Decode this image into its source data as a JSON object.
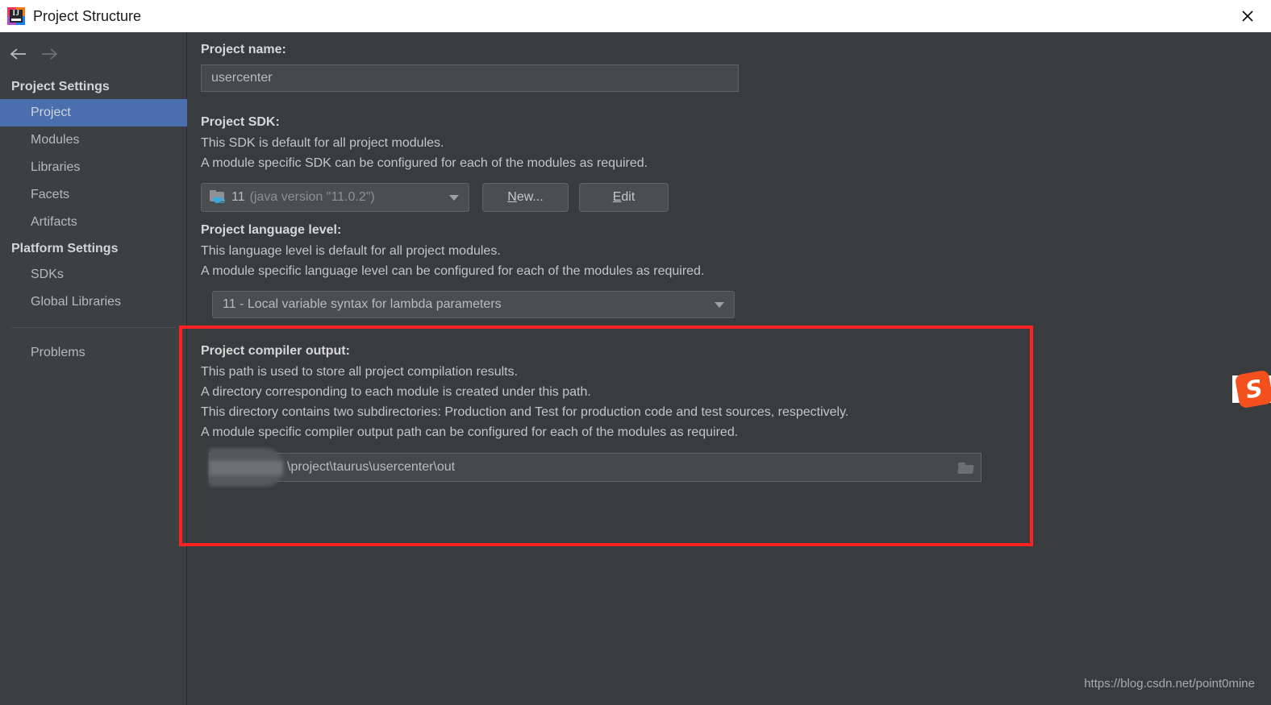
{
  "window": {
    "title": "Project Structure",
    "app_icon": "intellij-idea-icon",
    "icon_letters": "IJ",
    "close_label": "×"
  },
  "nav": {
    "back_icon": "arrow-left-icon",
    "forward_icon": "arrow-right-icon"
  },
  "sidebar": {
    "groups": [
      {
        "label": "Project Settings",
        "items": [
          {
            "label": "Project",
            "selected": true
          },
          {
            "label": "Modules",
            "selected": false
          },
          {
            "label": "Libraries",
            "selected": false
          },
          {
            "label": "Facets",
            "selected": false
          },
          {
            "label": "Artifacts",
            "selected": false
          }
        ]
      },
      {
        "label": "Platform Settings",
        "items": [
          {
            "label": "SDKs",
            "selected": false
          },
          {
            "label": "Global Libraries",
            "selected": false
          }
        ]
      }
    ],
    "problems": {
      "label": "Problems"
    }
  },
  "main": {
    "project_name": {
      "label": "Project name:",
      "value": "usercenter"
    },
    "project_sdk": {
      "label": "Project SDK:",
      "desc1": "This SDK is default for all project modules.",
      "desc2": "A module specific SDK can be configured for each of the modules as required.",
      "selected": "11",
      "selected_detail": "(java version \"11.0.2\")",
      "icon": "jdk-folder-icon",
      "new_button": {
        "mnemonic": "N",
        "rest": "ew..."
      },
      "edit_button": {
        "mnemonic": "E",
        "rest": "dit"
      }
    },
    "language_level": {
      "label": "Project language level:",
      "desc1": "This language level is default for all project modules.",
      "desc2": "A module specific language level can be configured for each of the modules as required.",
      "selected": "11 - Local variable syntax for lambda parameters"
    },
    "compiler_output": {
      "label": "Project compiler output:",
      "desc1": "This path is used to store all project compilation results.",
      "desc2": "A directory corresponding to each module is created under this path.",
      "desc3": "This directory contains two subdirectories: Production and Test for production code and test sources, respectively.",
      "desc4": "A module specific compiler output path can be configured for each of the modules as required.",
      "path_value": "\\project\\taurus\\usercenter\\out",
      "browse_icon": "folder-browse-icon"
    }
  },
  "overlays": {
    "highlight_color": "#fc2222",
    "watermark": "https://blog.csdn.net/point0mine",
    "sogou_letter": "S"
  },
  "colors": {
    "selection_blue": "#4b6eaf",
    "sidebar_bg": "#3c4043",
    "main_bg": "#393c3f",
    "accent_red": "#fc2222",
    "sogou_orange": "#f4501e"
  }
}
